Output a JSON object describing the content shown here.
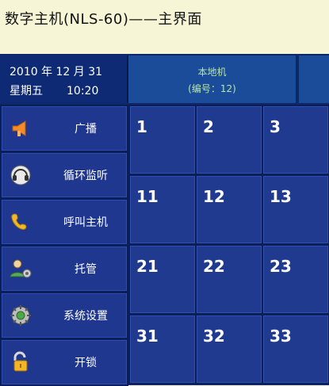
{
  "window": {
    "title": "数字主机(NLS-60)——主界面"
  },
  "status": {
    "date": "2010 年 12 月 31",
    "weekday": "星期五",
    "time": "10:20"
  },
  "local_host": {
    "name": "本地机",
    "number": "(编号：12)"
  },
  "menu": {
    "items": [
      {
        "label": "广播",
        "icon": "megaphone-icon"
      },
      {
        "label": "循环监听",
        "icon": "headset-icon"
      },
      {
        "label": "呼叫主机",
        "icon": "phone-icon"
      },
      {
        "label": "托管",
        "icon": "user-gear-icon"
      },
      {
        "label": "系统设置",
        "icon": "settings-gear-icon"
      },
      {
        "label": "开锁",
        "icon": "unlock-icon"
      }
    ]
  },
  "grid": {
    "cells": [
      "1",
      "2",
      "3",
      "11",
      "12",
      "13",
      "21",
      "22",
      "23",
      "31",
      "32",
      "33"
    ]
  },
  "colors": {
    "background": "#f6f5d6",
    "panel": "#0f2668",
    "button": "#20378f",
    "accent_text": "#b9e6a4"
  }
}
